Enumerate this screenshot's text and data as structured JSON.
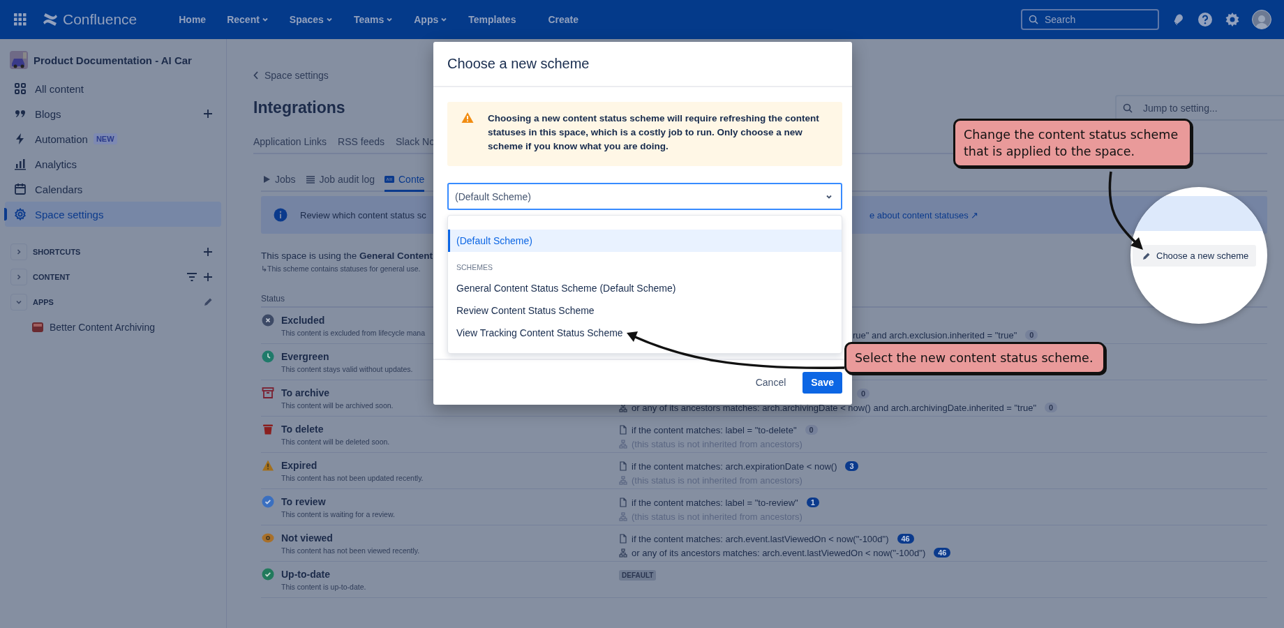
{
  "header": {
    "product": "Confluence",
    "nav": [
      {
        "label": "Home",
        "dropdown": false
      },
      {
        "label": "Recent",
        "dropdown": true
      },
      {
        "label": "Spaces",
        "dropdown": true
      },
      {
        "label": "Teams",
        "dropdown": true
      },
      {
        "label": "Apps",
        "dropdown": true
      },
      {
        "label": "Templates",
        "dropdown": false
      }
    ],
    "create": "Create",
    "search": {
      "placeholder": "Search"
    }
  },
  "sidebar": {
    "space_title": "Product Documentation - AI Car",
    "items": [
      {
        "label": "All content",
        "selected": false
      },
      {
        "label": "Blogs",
        "selected": false
      },
      {
        "label": "Automation",
        "badge": "NEW",
        "selected": false
      },
      {
        "label": "Analytics",
        "selected": false
      },
      {
        "label": "Calendars",
        "selected": false
      },
      {
        "label": "Space settings",
        "selected": true
      }
    ],
    "sections": [
      {
        "label": "SHORTCUTS",
        "expanded": false
      },
      {
        "label": "CONTENT",
        "expanded": false
      },
      {
        "label": "APPS",
        "expanded": true,
        "children": [
          {
            "label": "Better Content Archiving"
          }
        ]
      }
    ]
  },
  "page": {
    "breadcrumb": "Space settings",
    "title": "Integrations",
    "search": {
      "placeholder": "Jump to setting..."
    },
    "tabs": [
      {
        "label": "Application Links",
        "selected": false
      },
      {
        "label": "RSS feeds",
        "selected": false
      },
      {
        "label": "Slack No",
        "selected": false
      }
    ],
    "subtabs": [
      {
        "label": "Jobs",
        "selected": false
      },
      {
        "label": "Job audit log",
        "selected": false
      },
      {
        "label": "Conte",
        "selected": true
      }
    ],
    "banner": {
      "text": "Review which content status sc",
      "link": "e about content statuses ↗"
    },
    "scheme_note": "This space is using the **General Content**",
    "scheme_hint": "↳This scheme contains statuses for general use.",
    "table": {
      "columns": [
        "Status"
      ],
      "rows": [
        {
          "name": "Excluded",
          "description": "This content is excluded from lifecycle mana",
          "color": "#3d4a66",
          "conditions": [
            {
              "kind": "ancestor",
              "clipped": true,
              "text": "rue\" and arch.exclusion.inherited = \"true\"",
              "count": "0",
              "highlighted": false
            }
          ]
        },
        {
          "name": "Evergreen",
          "description": "This content stays valid without updates.",
          "color": "#1f7a6a"
        },
        {
          "name": "To archive",
          "description": "This content will be archived soon.",
          "color": "#7a2030",
          "conditions": [
            {
              "kind": "match",
              "clipped": true,
              "count": "0",
              "highlighted": false
            },
            {
              "kind": "ancestor",
              "clipped": false,
              "text": "or any of its ancestors matches: arch.archivingDate < now() and arch.archivingDate.inherited = \"true\"",
              "count": "0",
              "highlighted": false
            }
          ]
        },
        {
          "name": "To delete",
          "description": "This content will be deleted soon.",
          "color": "#8a1f1f",
          "conditions": [
            {
              "kind": "match",
              "clipped": false,
              "text": "if the content matches: label = \"to-delete\"",
              "count": "0",
              "highlighted": false
            },
            {
              "kind": "none",
              "clipped": false,
              "text": "(this status is not inherited from ancestors)"
            }
          ]
        },
        {
          "name": "Expired",
          "description": "This content has not been updated recently.",
          "color": "#a3701c",
          "conditions": [
            {
              "kind": "match",
              "clipped": false,
              "text": "if the content matches: arch.expirationDate < now()",
              "count": "3",
              "highlighted": true
            },
            {
              "kind": "none",
              "clipped": false,
              "text": "(this status is not inherited from ancestors)"
            }
          ]
        },
        {
          "name": "To review",
          "description": "This content is waiting for a review.",
          "color": "#3a6fc0",
          "conditions": [
            {
              "kind": "match",
              "clipped": false,
              "text": "if the content matches: label = \"to-review\"",
              "count": "1",
              "highlighted": true
            },
            {
              "kind": "none",
              "clipped": false,
              "text": "(this status is not inherited from ancestors)"
            }
          ]
        },
        {
          "name": "Not viewed",
          "description": "This content has not been viewed recently.",
          "color": "#a8702a",
          "conditions": [
            {
              "kind": "match",
              "clipped": false,
              "text": "if the content matches: arch.event.lastViewedOn < now(\"-100d\")",
              "count": "46",
              "highlighted": true
            },
            {
              "kind": "ancestor",
              "clipped": false,
              "text": "or any of its ancestors matches: arch.event.lastViewedOn < now(\"-100d\")",
              "count": "46",
              "highlighted": true
            }
          ]
        },
        {
          "name": "Up-to-date",
          "description": "This content is up-to-date.",
          "color": "#217a5c",
          "conditions": [
            {
              "kind": "lozenge",
              "text": "DEFAULT"
            }
          ]
        }
      ]
    }
  },
  "dialog": {
    "title": "Choose a new scheme",
    "warning": "Choosing a new content status scheme will require refreshing the content statuses in this space, which is a costly job to run. Only choose a new scheme if you know what you are doing.",
    "select": {
      "value": "(Default Scheme)"
    },
    "menu": {
      "options": [
        {
          "label": "(Default Scheme)",
          "selected": true
        }
      ],
      "groups": [
        {
          "label": "SCHEMES",
          "options": [
            {
              "label": "General Content Status Scheme (Default Scheme)",
              "selected": false
            },
            {
              "label": "Review Content Status Scheme",
              "selected": false
            },
            {
              "label": "View Tracking Content Status Scheme",
              "selected": false
            }
          ]
        }
      ]
    },
    "buttons": [
      {
        "label": "Cancel",
        "kind": "subtle"
      },
      {
        "label": "Save",
        "kind": "primary"
      }
    ]
  },
  "annotations": {
    "callouts": [
      {
        "text": "Change the content status scheme that is applied to the space."
      },
      {
        "text": "Select the new content status scheme."
      }
    ],
    "magnifier": {
      "button": "Choose a new scheme"
    }
  }
}
